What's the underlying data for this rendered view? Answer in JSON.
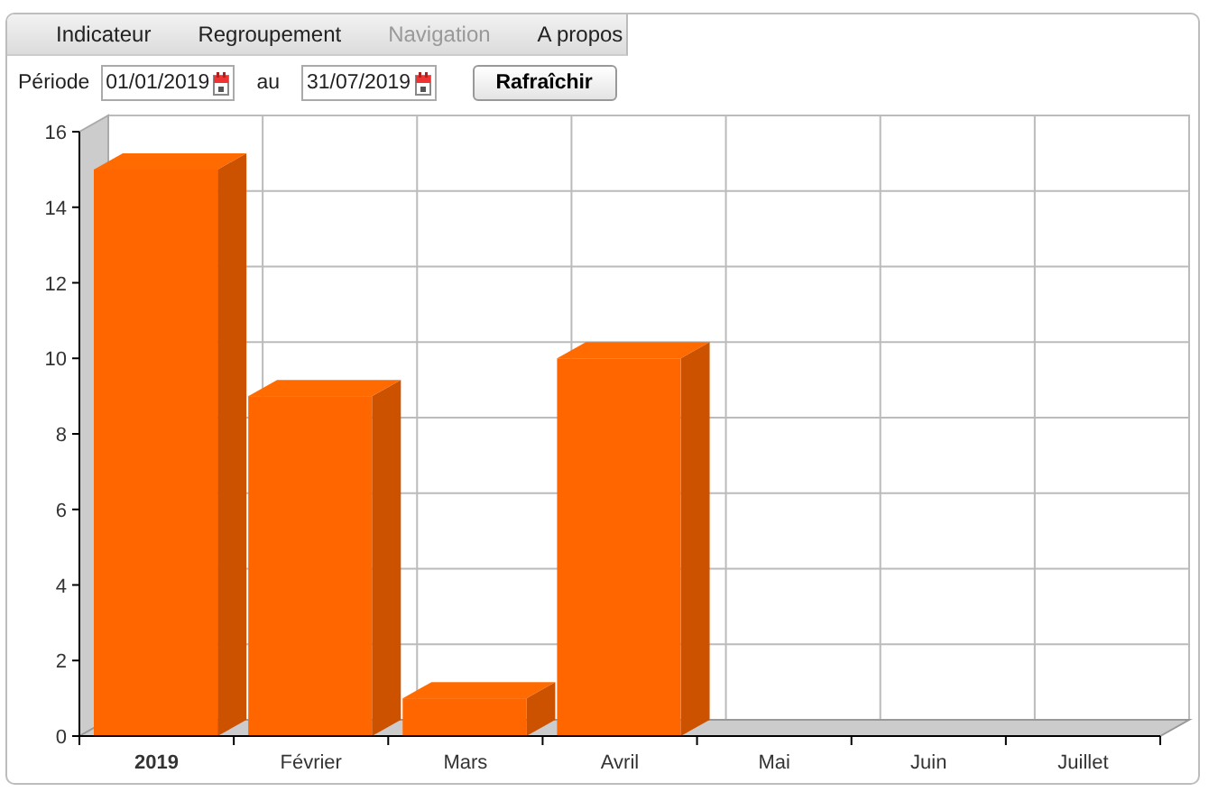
{
  "tabs": [
    {
      "label": "Indicateur",
      "disabled": false
    },
    {
      "label": "Regroupement",
      "disabled": false
    },
    {
      "label": "Navigation",
      "disabled": true
    },
    {
      "label": "A propos",
      "disabled": false
    }
  ],
  "period": {
    "label": "Période",
    "from": "01/01/2019",
    "separator": "au",
    "to": "31/07/2019",
    "button": "Rafraîchir"
  },
  "chart": {
    "emphasized_first_category": true,
    "chart_data": {
      "type": "bar",
      "categories": [
        "2019",
        "Février",
        "Mars",
        "Avril",
        "Mai",
        "Juin",
        "Juillet"
      ],
      "series": [
        {
          "color": "#ff6600",
          "values": [
            15,
            9,
            1,
            10,
            0,
            0,
            0
          ]
        }
      ],
      "ylim": [
        0,
        16
      ],
      "yticks": [
        0,
        2,
        4,
        6,
        8,
        10,
        12,
        14,
        16
      ]
    }
  }
}
